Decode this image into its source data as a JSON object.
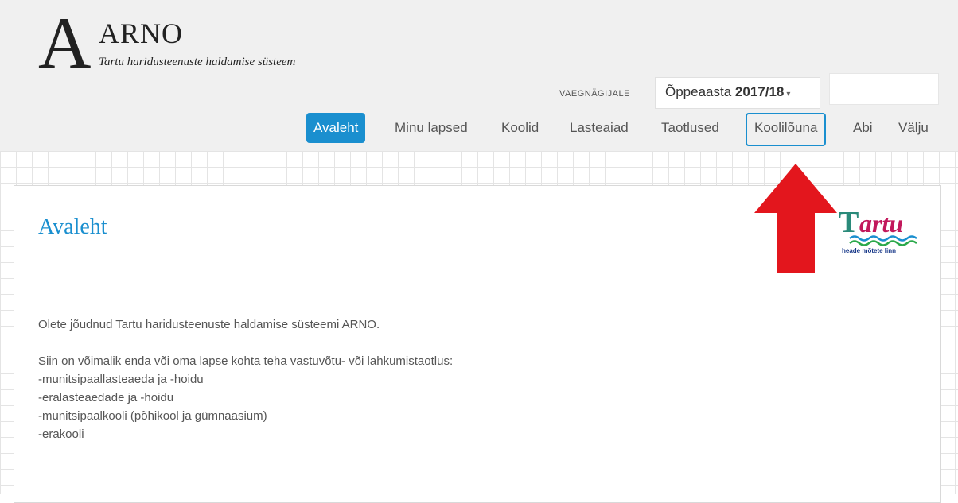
{
  "header": {
    "logo_letter": "A",
    "app_name": "ARNO",
    "app_subtitle": "Tartu haridusteenuste haldamise süsteem",
    "viewer_label": "VAEGNÄGIJALE",
    "year_label": "Õppeaasta",
    "year_value": "2017/18",
    "search_value": ""
  },
  "nav": {
    "items": [
      "Avaleht",
      "Minu lapsed",
      "Koolid",
      "Lasteaiad",
      "Taotlused",
      "Koolilõuna",
      "Abi",
      "Välju"
    ]
  },
  "main": {
    "title": "Avaleht",
    "intro": "Olete jõudnud Tartu haridusteenuste haldamise süsteemi ARNO.",
    "paragraph": "Siin on võimalik enda või oma lapse kohta teha vastuvõtu- või lahkumistaotlus:",
    "list": [
      "-munitsipaallasteaeda ja -hoidu",
      "-eralasteaedade ja -hoidu",
      "-munitsipaalkooli (põhikool ja gümnaasium)",
      "-erakooli"
    ]
  },
  "city_logo": {
    "name": "Tartu",
    "slogan": "heade mõtete linn"
  },
  "colors": {
    "accent": "#1a8fcf",
    "arrow": "#e3161d",
    "header_bg": "#f0f0f0"
  }
}
